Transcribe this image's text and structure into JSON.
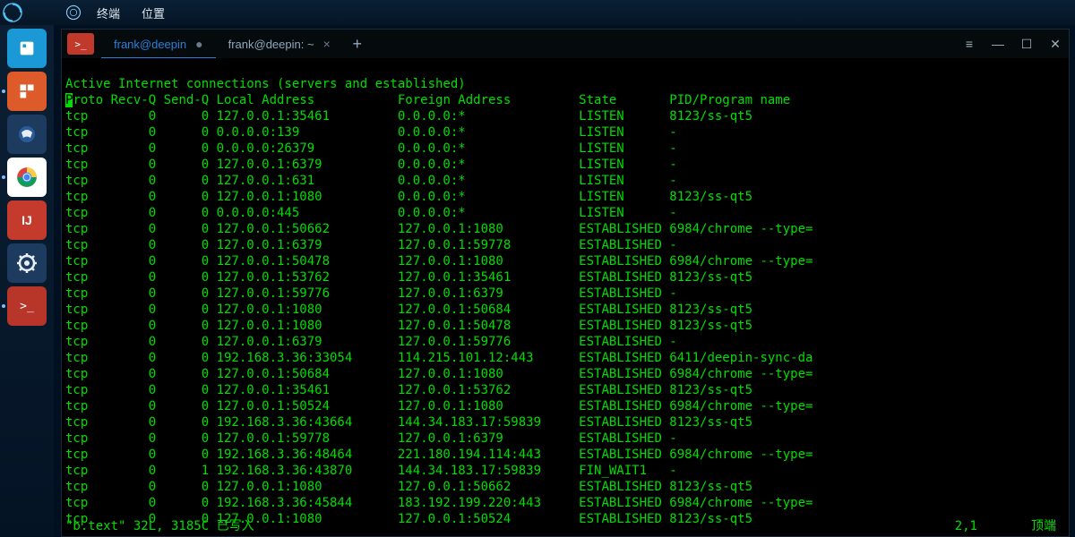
{
  "topbar": {
    "menu1": "终端",
    "menu2": "位置"
  },
  "tabs": {
    "t1": "frank@deepin",
    "t2": "frank@deepin: ~"
  },
  "header": {
    "title": "Active Internet connections (servers and established)",
    "cols": "Proto Recv-Q Send-Q Local Address           Foreign Address         State       PID/Program name"
  },
  "rows": [
    {
      "p": "tcp",
      "r": "0",
      "s": "0",
      "la": "127.0.0.1:35461",
      "fa": "0.0.0.0:*",
      "st": "LISTEN",
      "pg": "8123/ss-qt5"
    },
    {
      "p": "tcp",
      "r": "0",
      "s": "0",
      "la": "0.0.0.0:139",
      "fa": "0.0.0.0:*",
      "st": "LISTEN",
      "pg": "-"
    },
    {
      "p": "tcp",
      "r": "0",
      "s": "0",
      "la": "0.0.0.0:26379",
      "fa": "0.0.0.0:*",
      "st": "LISTEN",
      "pg": "-"
    },
    {
      "p": "tcp",
      "r": "0",
      "s": "0",
      "la": "127.0.0.1:6379",
      "fa": "0.0.0.0:*",
      "st": "LISTEN",
      "pg": "-"
    },
    {
      "p": "tcp",
      "r": "0",
      "s": "0",
      "la": "127.0.0.1:631",
      "fa": "0.0.0.0:*",
      "st": "LISTEN",
      "pg": "-"
    },
    {
      "p": "tcp",
      "r": "0",
      "s": "0",
      "la": "127.0.0.1:1080",
      "fa": "0.0.0.0:*",
      "st": "LISTEN",
      "pg": "8123/ss-qt5"
    },
    {
      "p": "tcp",
      "r": "0",
      "s": "0",
      "la": "0.0.0.0:445",
      "fa": "0.0.0.0:*",
      "st": "LISTEN",
      "pg": "-"
    },
    {
      "p": "tcp",
      "r": "0",
      "s": "0",
      "la": "127.0.0.1:50662",
      "fa": "127.0.0.1:1080",
      "st": "ESTABLISHED",
      "pg": "6984/chrome --type="
    },
    {
      "p": "tcp",
      "r": "0",
      "s": "0",
      "la": "127.0.0.1:6379",
      "fa": "127.0.0.1:59778",
      "st": "ESTABLISHED",
      "pg": "-"
    },
    {
      "p": "tcp",
      "r": "0",
      "s": "0",
      "la": "127.0.0.1:50478",
      "fa": "127.0.0.1:1080",
      "st": "ESTABLISHED",
      "pg": "6984/chrome --type="
    },
    {
      "p": "tcp",
      "r": "0",
      "s": "0",
      "la": "127.0.0.1:53762",
      "fa": "127.0.0.1:35461",
      "st": "ESTABLISHED",
      "pg": "8123/ss-qt5"
    },
    {
      "p": "tcp",
      "r": "0",
      "s": "0",
      "la": "127.0.0.1:59776",
      "fa": "127.0.0.1:6379",
      "st": "ESTABLISHED",
      "pg": "-"
    },
    {
      "p": "tcp",
      "r": "0",
      "s": "0",
      "la": "127.0.0.1:1080",
      "fa": "127.0.0.1:50684",
      "st": "ESTABLISHED",
      "pg": "8123/ss-qt5"
    },
    {
      "p": "tcp",
      "r": "0",
      "s": "0",
      "la": "127.0.0.1:1080",
      "fa": "127.0.0.1:50478",
      "st": "ESTABLISHED",
      "pg": "8123/ss-qt5"
    },
    {
      "p": "tcp",
      "r": "0",
      "s": "0",
      "la": "127.0.0.1:6379",
      "fa": "127.0.0.1:59776",
      "st": "ESTABLISHED",
      "pg": "-"
    },
    {
      "p": "tcp",
      "r": "0",
      "s": "0",
      "la": "192.168.3.36:33054",
      "fa": "114.215.101.12:443",
      "st": "ESTABLISHED",
      "pg": "6411/deepin-sync-da"
    },
    {
      "p": "tcp",
      "r": "0",
      "s": "0",
      "la": "127.0.0.1:50684",
      "fa": "127.0.0.1:1080",
      "st": "ESTABLISHED",
      "pg": "6984/chrome --type="
    },
    {
      "p": "tcp",
      "r": "0",
      "s": "0",
      "la": "127.0.0.1:35461",
      "fa": "127.0.0.1:53762",
      "st": "ESTABLISHED",
      "pg": "8123/ss-qt5"
    },
    {
      "p": "tcp",
      "r": "0",
      "s": "0",
      "la": "127.0.0.1:50524",
      "fa": "127.0.0.1:1080",
      "st": "ESTABLISHED",
      "pg": "6984/chrome --type="
    },
    {
      "p": "tcp",
      "r": "0",
      "s": "0",
      "la": "192.168.3.36:43664",
      "fa": "144.34.183.17:59839",
      "st": "ESTABLISHED",
      "pg": "8123/ss-qt5"
    },
    {
      "p": "tcp",
      "r": "0",
      "s": "0",
      "la": "127.0.0.1:59778",
      "fa": "127.0.0.1:6379",
      "st": "ESTABLISHED",
      "pg": "-"
    },
    {
      "p": "tcp",
      "r": "0",
      "s": "0",
      "la": "192.168.3.36:48464",
      "fa": "221.180.194.114:443",
      "st": "ESTABLISHED",
      "pg": "6984/chrome --type="
    },
    {
      "p": "tcp",
      "r": "0",
      "s": "1",
      "la": "192.168.3.36:43870",
      "fa": "144.34.183.17:59839",
      "st": "FIN_WAIT1",
      "pg": "-"
    },
    {
      "p": "tcp",
      "r": "0",
      "s": "0",
      "la": "127.0.0.1:1080",
      "fa": "127.0.0.1:50662",
      "st": "ESTABLISHED",
      "pg": "8123/ss-qt5"
    },
    {
      "p": "tcp",
      "r": "0",
      "s": "0",
      "la": "192.168.3.36:45844",
      "fa": "183.192.199.220:443",
      "st": "ESTABLISHED",
      "pg": "6984/chrome --type="
    },
    {
      "p": "tcp",
      "r": "0",
      "s": "0",
      "la": "127.0.0.1:1080",
      "fa": "127.0.0.1:50524",
      "st": "ESTABLISHED",
      "pg": "8123/ss-qt5"
    }
  ],
  "status": {
    "file": "\"b.text\" 32L, 3185C 已写入",
    "pos": "2,1",
    "bot": "顶端"
  }
}
